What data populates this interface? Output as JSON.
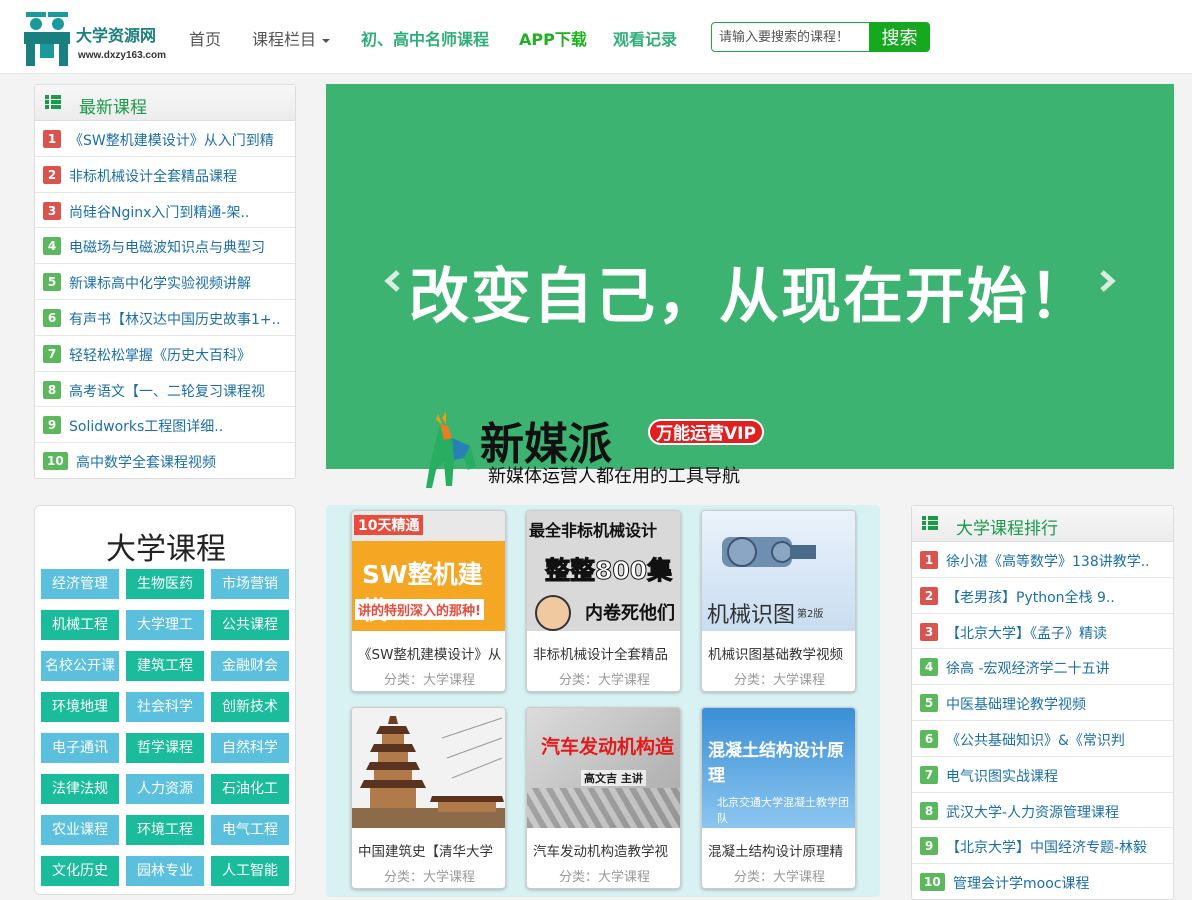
{
  "header": {
    "logo_name": "大学资源网",
    "logo_url": "www.dxzy163.com",
    "nav": {
      "home": "首页",
      "categories": "课程栏目",
      "teachers": "初、高中名师课程",
      "app": "APP下载",
      "history": "观看记录"
    },
    "search": {
      "placeholder": "请输入要搜索的课程！",
      "button": "搜索"
    }
  },
  "latest": {
    "title": "最新课程",
    "items": [
      {
        "num": "1",
        "text": "《SW整机建模设计》从入门到精"
      },
      {
        "num": "2",
        "text": "非标机械设计全套精品课程"
      },
      {
        "num": "3",
        "text": "尚硅谷Nginx入门到精通-架.."
      },
      {
        "num": "4",
        "text": "电磁场与电磁波知识点与典型习"
      },
      {
        "num": "5",
        "text": "新课标高中化学实验视频讲解"
      },
      {
        "num": "6",
        "text": "有声书【林汉达中国历史故事1+.."
      },
      {
        "num": "7",
        "text": "轻轻松松掌握《历史大百科》"
      },
      {
        "num": "8",
        "text": "高考语文【一、二轮复习课程视"
      },
      {
        "num": "9",
        "text": "Solidworks工程图详细.."
      },
      {
        "num": "10",
        "text": "高中数学全套课程视频"
      }
    ]
  },
  "banner": {
    "slogan": "改变自己，从现在开始！",
    "ad_brand": "新媒派",
    "ad_vip": "万能运营VIP",
    "ad_tagline": "新媒体运营人都在用的工具导航"
  },
  "university": {
    "title": "大学课程",
    "categories": [
      "经济管理",
      "生物医药",
      "市场营销",
      "机械工程",
      "大学理工",
      "公共课程",
      "名校公开课",
      "建筑工程",
      "金融财会",
      "环境地理",
      "社会科学",
      "创新技术",
      "电子通讯",
      "哲学课程",
      "自然科学",
      "法律法规",
      "人力资源",
      "石油化工",
      "农业课程",
      "环境工程",
      "电气工程",
      "文化历史",
      "园林专业",
      "人工智能"
    ]
  },
  "courses": [
    {
      "title": "《SW整机建模设计》从",
      "category": "分类：大学课程",
      "thumb_top": "10天精通",
      "thumb_main": "SW整机建模",
      "thumb_sub": "讲的特别深入的那种!"
    },
    {
      "title": "非标机械设计全套精品",
      "category": "分类：大学课程",
      "thumb_top": "最全非标机械设计",
      "thumb_main": "整整800集",
      "thumb_sub": "内卷死他们"
    },
    {
      "title": "机械识图基础教学视频",
      "category": "分类：大学课程",
      "thumb_main": "机械识图",
      "thumb_sub": "第2版"
    },
    {
      "title": "中国建筑史【清华大学",
      "category": "分类：大学课程"
    },
    {
      "title": "汽车发动机构造教学视",
      "category": "分类：大学课程",
      "thumb_main": "汽车发动机构造",
      "thumb_sub": "高文吉 主讲"
    },
    {
      "title": "混凝土结构设计原理精",
      "category": "分类：大学课程",
      "thumb_main": "混凝土结构设计原理",
      "thumb_sub": "北京交通大学混凝土教学团队"
    }
  ],
  "ranking": {
    "title": "大学课程排行",
    "items": [
      {
        "num": "1",
        "text": "徐小湛《高等数学》138讲教学.."
      },
      {
        "num": "2",
        "text": "【老男孩】Python全栈 9.."
      },
      {
        "num": "3",
        "text": "【北京大学】《孟子》精读"
      },
      {
        "num": "4",
        "text": "徐高 -宏观经济学二十五讲"
      },
      {
        "num": "5",
        "text": "中医基础理论教学视频"
      },
      {
        "num": "6",
        "text": "《公共基础知识》&《常识判"
      },
      {
        "num": "7",
        "text": "电气识图实战课程"
      },
      {
        "num": "8",
        "text": "武汉大学-人力资源管理课程"
      },
      {
        "num": "9",
        "text": "【北京大学】中国经济专题-林毅"
      },
      {
        "num": "10",
        "text": "管理会计学mooc课程"
      }
    ]
  }
}
